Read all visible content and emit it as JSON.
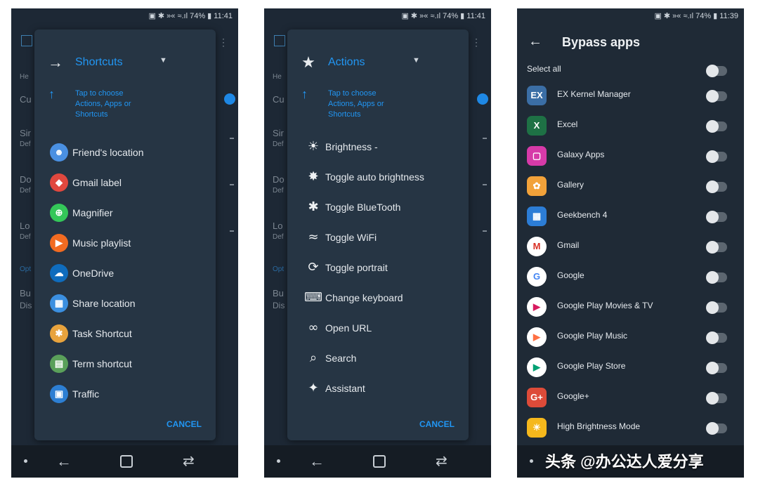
{
  "status": {
    "left": "▣ ✱ »« ≈.ıl 74% ▮ 11:41",
    "right": "▣ ✱ »« ≈.ıl 74% ▮ 11:39"
  },
  "background_labels": [
    "He",
    "Cu",
    "Sir",
    "Def",
    "Do",
    "Def",
    "Lo",
    "Def",
    "Opt",
    "Bu",
    "Dis"
  ],
  "shortcuts_dialog": {
    "title": "Shortcuts",
    "hint": "Tap to choose Actions, Apps or Shortcuts",
    "items": [
      {
        "label": "Friend's location",
        "icon": "friend-location-icon",
        "color": "#4a90e2",
        "glyph": "☻"
      },
      {
        "label": "Gmail label",
        "icon": "gmail-label-icon",
        "color": "#e0483e",
        "glyph": "◆"
      },
      {
        "label": "Magnifier",
        "icon": "magnifier-icon",
        "color": "#34c759",
        "glyph": "⊕"
      },
      {
        "label": "Music playlist",
        "icon": "music-playlist-icon",
        "color": "#f26b21",
        "glyph": "▶"
      },
      {
        "label": "OneDrive",
        "icon": "onedrive-icon",
        "color": "#0f6cbd",
        "glyph": "☁"
      },
      {
        "label": "Share location",
        "icon": "share-location-icon",
        "color": "#3b8fe0",
        "glyph": "▦"
      },
      {
        "label": "Task Shortcut",
        "icon": "task-shortcut-icon",
        "color": "#e8a33d",
        "glyph": "✱"
      },
      {
        "label": "Term shortcut",
        "icon": "term-shortcut-icon",
        "color": "#5aa05a",
        "glyph": "▤"
      },
      {
        "label": "Traffic",
        "icon": "traffic-icon",
        "color": "#2d7fd3",
        "glyph": "▣"
      }
    ],
    "cancel": "CANCEL"
  },
  "actions_dialog": {
    "title": "Actions",
    "hint": "Tap to choose Actions, Apps or Shortcuts",
    "items": [
      {
        "label": "Brightness -",
        "icon": "brightness-icon",
        "glyph": "☀"
      },
      {
        "label": "Toggle auto brightness",
        "icon": "auto-brightness-icon",
        "glyph": "✸"
      },
      {
        "label": "Toggle BlueTooth",
        "icon": "bluetooth-icon",
        "glyph": "✱"
      },
      {
        "label": "Toggle WiFi",
        "icon": "wifi-icon",
        "glyph": "≈"
      },
      {
        "label": "Toggle portrait",
        "icon": "rotate-icon",
        "glyph": "⟳"
      },
      {
        "label": "Change keyboard",
        "icon": "keyboard-icon",
        "glyph": "⌨"
      },
      {
        "label": "Open URL",
        "icon": "link-icon",
        "glyph": "∞"
      },
      {
        "label": "Search",
        "icon": "search-icon",
        "glyph": "⌕"
      },
      {
        "label": "Assistant",
        "icon": "assistant-icon",
        "glyph": "✦"
      }
    ],
    "cancel": "CANCEL"
  },
  "bypass_apps": {
    "title": "Bypass apps",
    "select_all": "Select all",
    "apps": [
      {
        "label": "EX Kernel Manager",
        "icon": "ex-kernel-icon",
        "color": "#3b6ea5",
        "glyph": "EX"
      },
      {
        "label": "Excel",
        "icon": "excel-icon",
        "color": "#1e7145",
        "glyph": "X"
      },
      {
        "label": "Galaxy Apps",
        "icon": "galaxy-apps-icon",
        "color": "#d63aa8",
        "glyph": "▢"
      },
      {
        "label": "Gallery",
        "icon": "gallery-icon",
        "color": "#f2a23a",
        "glyph": "✿"
      },
      {
        "label": "Geekbench 4",
        "icon": "geekbench-icon",
        "color": "#2c7dd6",
        "glyph": "▦"
      },
      {
        "label": "Gmail",
        "icon": "gmail-icon",
        "color": "#ffffff",
        "glyph": "M"
      },
      {
        "label": "Google",
        "icon": "google-icon",
        "color": "#ffffff",
        "glyph": "G"
      },
      {
        "label": "Google Play Movies & TV",
        "icon": "play-movies-icon",
        "color": "#ffffff",
        "glyph": "▶"
      },
      {
        "label": "Google Play Music",
        "icon": "play-music-icon",
        "color": "#ffffff",
        "glyph": "▶"
      },
      {
        "label": "Google Play Store",
        "icon": "play-store-icon",
        "color": "#ffffff",
        "glyph": "▶"
      },
      {
        "label": "Google+",
        "icon": "google-plus-icon",
        "color": "#dd4b39",
        "glyph": "G+"
      },
      {
        "label": "High Brightness Mode",
        "icon": "high-brightness-icon",
        "color": "#f5b81c",
        "glyph": "☀"
      }
    ]
  },
  "watermark": "头条 @办公达人爱分享",
  "colors": {
    "accent": "#2196f3",
    "dialog": "#263544",
    "background": "#1d2835"
  }
}
